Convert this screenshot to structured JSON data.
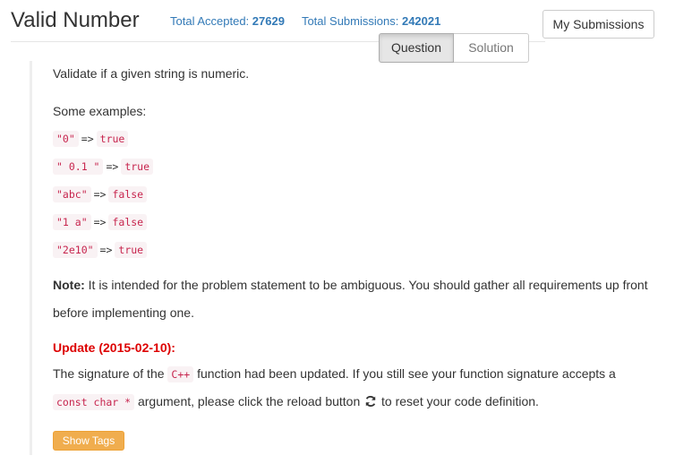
{
  "header": {
    "title": "Valid Number",
    "total_accepted_label": "Total Accepted:",
    "total_accepted": "27629",
    "total_submissions_label": "Total Submissions:",
    "total_submissions": "242021",
    "my_submissions_button": "My Submissions"
  },
  "tabs": [
    {
      "label": "Question",
      "active": true
    },
    {
      "label": "Solution",
      "active": false
    }
  ],
  "description": {
    "intro": "Validate if a given string is numeric.",
    "examples_label": "Some examples:",
    "arrow": "=>",
    "examples": [
      {
        "input": "\"0\"",
        "output": "true"
      },
      {
        "input": "\" 0.1 \"",
        "output": "true"
      },
      {
        "input": "\"abc\"",
        "output": "false"
      },
      {
        "input": "\"1 a\"",
        "output": "false"
      },
      {
        "input": "\"2e10\"",
        "output": "true"
      }
    ],
    "note_label": "Note:",
    "note_line1": " It is intended for the problem statement to be ambiguous. You should gather all requirements up front",
    "note_line2": "before implementing one.",
    "update_heading": "Update (2015-02-10):",
    "update_line1_pre": "The signature of the ",
    "update_code_lang": "C++",
    "update_line1_post": " function had been updated. If you still see your function signature accepts a",
    "update_code_type": "const char *",
    "update_line2_mid": " argument, please click the reload button ",
    "update_line2_post": " to reset your code definition."
  },
  "show_tags_button": "Show Tags",
  "colors": {
    "link_blue": "#337ab7",
    "code_red": "#c7254e",
    "code_bg": "#f9f2f4",
    "update_red": "#dd0000",
    "warning_orange": "#f0ad4e"
  },
  "icons": {
    "reload": "reload-icon"
  }
}
